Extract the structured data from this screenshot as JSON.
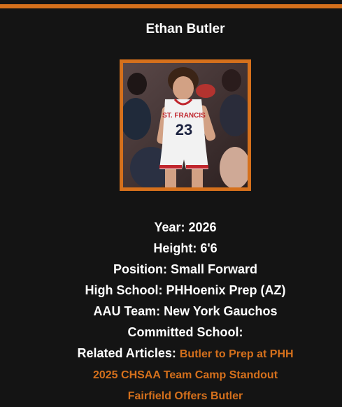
{
  "player": {
    "name": "Ethan Butler",
    "jersey_text": "ST. FRANCIS",
    "jersey_number": "23"
  },
  "colors": {
    "accent": "#d5701c",
    "background": "#141414",
    "text": "#ffffff"
  },
  "details": [
    {
      "label": "Year:",
      "value": "2026"
    },
    {
      "label": "Height:",
      "value": "6'6"
    },
    {
      "label": "Position:",
      "value": "Small Forward"
    },
    {
      "label": "High School:",
      "value": "PHHoenix Prep (AZ)"
    },
    {
      "label": "AAU Team:",
      "value": "New York Gauchos"
    },
    {
      "label": "Committed School:",
      "value": ""
    }
  ],
  "related_articles": {
    "label": "Related Articles:",
    "links": [
      "Butler to Prep at PHH",
      "2025 CHSAA Team Camp Standout",
      "Fairfield Offers Butler"
    ]
  }
}
